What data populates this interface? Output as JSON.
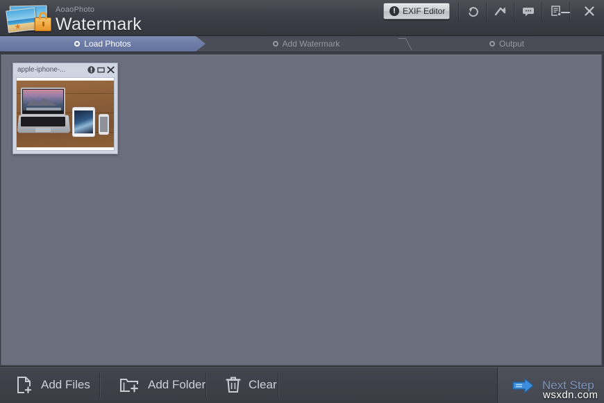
{
  "window": {
    "brand_sub": "AoaoPhoto",
    "brand_main": "Watermark",
    "logo_icon": "photo-lock-logo-icon"
  },
  "titlebar": {
    "exif_button": {
      "label": "EXIF Editor",
      "icon": "exclamation-circle-icon"
    },
    "tools": [
      {
        "name": "undo-icon",
        "title": "Undo"
      },
      {
        "name": "redo-arrow-icon",
        "title": "Redo"
      },
      {
        "name": "feedback-bubble-icon",
        "title": "Feedback"
      },
      {
        "name": "register-document-icon",
        "title": "Register"
      }
    ],
    "window_controls": [
      {
        "name": "minimize-icon",
        "glyph": "–"
      },
      {
        "name": "close-icon",
        "glyph": "✕"
      }
    ]
  },
  "steps": [
    {
      "label": "Load Photos",
      "state": "active"
    },
    {
      "label": "Add Watermark",
      "state": "inactive"
    },
    {
      "label": "Output",
      "state": "inactive"
    }
  ],
  "photo_cards": [
    {
      "title": "apple-iphone-...",
      "actions": [
        {
          "name": "info-icon"
        },
        {
          "name": "maximize-icon"
        },
        {
          "name": "close-icon"
        }
      ],
      "thumbnail_alt": "MacBook, iPad and iPhone on wooden desk"
    }
  ],
  "bottombar": {
    "buttons": [
      {
        "label": "Add Files",
        "icon": "file-add-icon"
      },
      {
        "label": "Add Folder",
        "icon": "folder-add-icon"
      },
      {
        "label": "Clear",
        "icon": "trash-icon"
      }
    ],
    "next": {
      "label": "Next Step",
      "icon": "arrow-right-icon"
    }
  },
  "overlay": {
    "watermark_text": "wsxdn.com"
  },
  "colors": {
    "accent_blue": "#6c7ca6",
    "content_bg": "#6b6f7d",
    "chrome_dark": "#3a3d45",
    "next_label": "#7e93b8",
    "lock_orange": "#e89326"
  }
}
